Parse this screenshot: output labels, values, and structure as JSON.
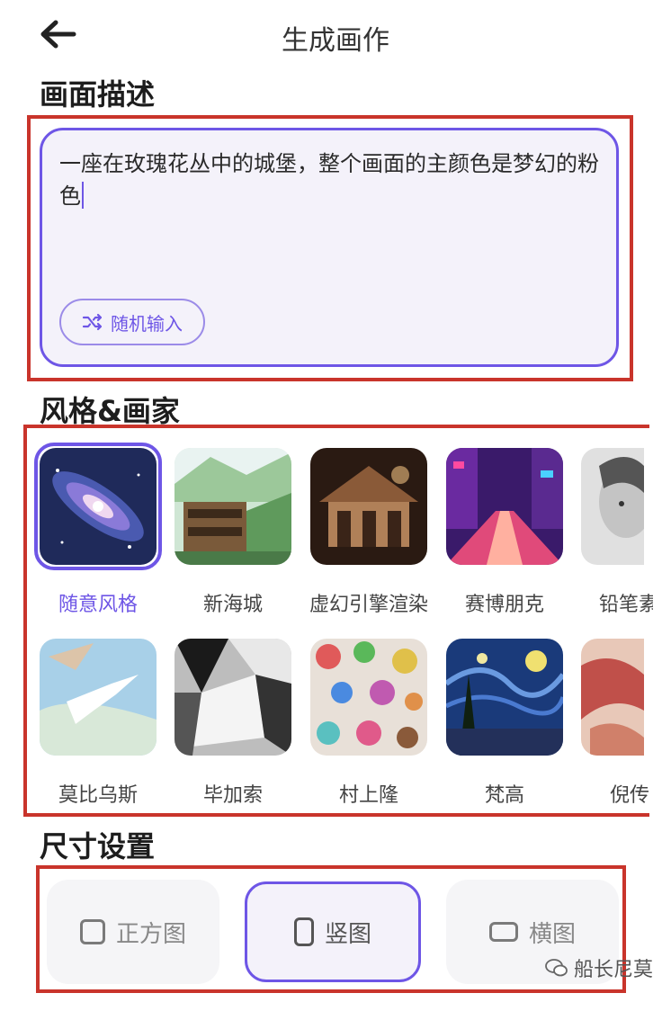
{
  "header": {
    "title": "生成画作",
    "back_icon": "arrow-left-icon"
  },
  "prompt_section": {
    "label": "画面描述",
    "text": "一座在玫瑰花丛中的城堡，整个画面的主颜色是梦幻的粉色",
    "random_button": "随机输入",
    "random_icon": "shuffle-icon"
  },
  "style_section": {
    "label": "风格&画家",
    "selected": "随意风格",
    "styles": [
      {
        "label": "随意风格"
      },
      {
        "label": "新海城"
      },
      {
        "label": "虚幻引擎渲染"
      },
      {
        "label": "赛博朋克"
      },
      {
        "label": "铅笔素"
      },
      {
        "label": "莫比乌斯"
      },
      {
        "label": "毕加索"
      },
      {
        "label": "村上隆"
      },
      {
        "label": "梵高"
      },
      {
        "label": "倪传"
      }
    ]
  },
  "size_section": {
    "label": "尺寸设置",
    "options": [
      {
        "label": "正方图"
      },
      {
        "label": "竖图"
      },
      {
        "label": "横图"
      }
    ],
    "selected": "竖图"
  },
  "watermark": "船长尼莫",
  "colors": {
    "accent": "#6e56e6",
    "annotation": "#c9342b"
  }
}
